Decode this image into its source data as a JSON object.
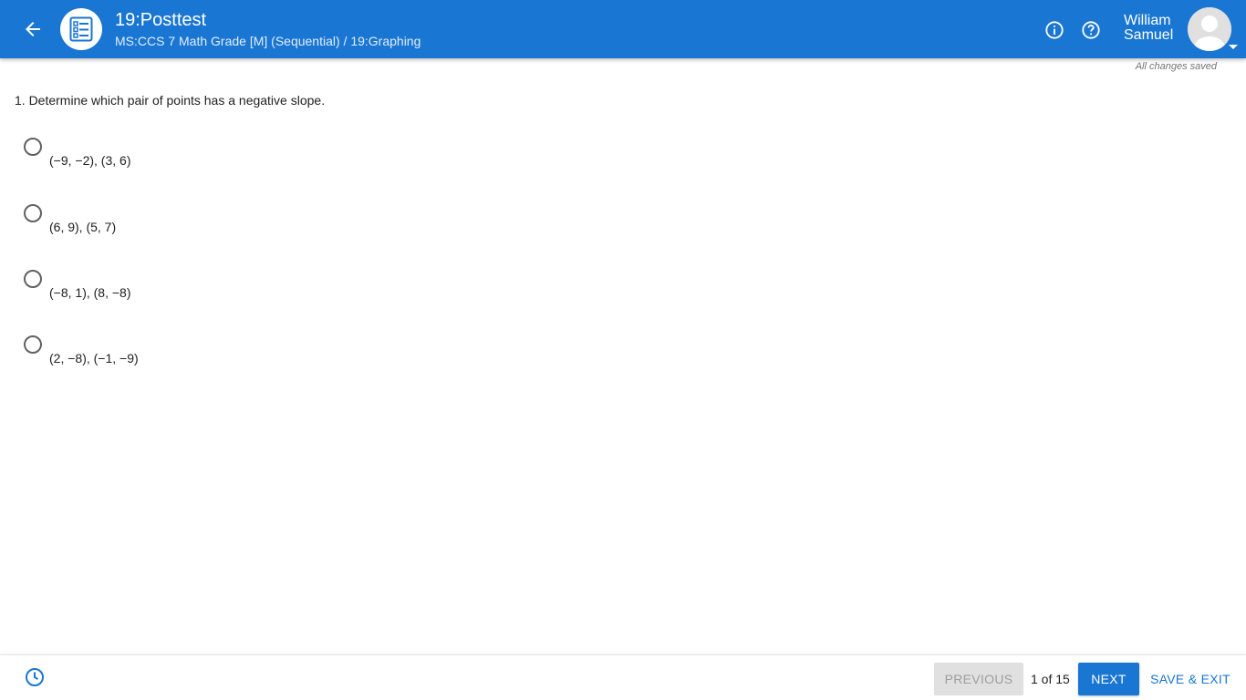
{
  "header": {
    "back_icon": "arrow-left-icon",
    "app_icon": "checklist-icon",
    "title": "19:Posttest",
    "breadcrumb": "MS:CCS 7 Math Grade [M] (Sequential) / 19:Graphing",
    "info_icon": "info-icon",
    "help_icon": "help-icon",
    "user": {
      "first_name": "William",
      "last_name": "Samuel"
    },
    "accent_color": "#1976d2"
  },
  "status": {
    "saved_text": "All changes saved"
  },
  "question": {
    "text": "1. Determine which pair of points has a negative slope.",
    "choices": [
      {
        "label": "(−9, −2), (3, 6)",
        "selected": false
      },
      {
        "label": "(6, 9), (5, 7)",
        "selected": false
      },
      {
        "label": "(−8, 1), (8, −8)",
        "selected": false
      },
      {
        "label": "(2, −8), (−1, −9)",
        "selected": false
      }
    ]
  },
  "footer": {
    "clock_icon": "clock-icon",
    "previous_label": "PREVIOUS",
    "page_count": "1 of 15",
    "next_label": "NEXT",
    "save_exit_label": "SAVE & EXIT"
  }
}
